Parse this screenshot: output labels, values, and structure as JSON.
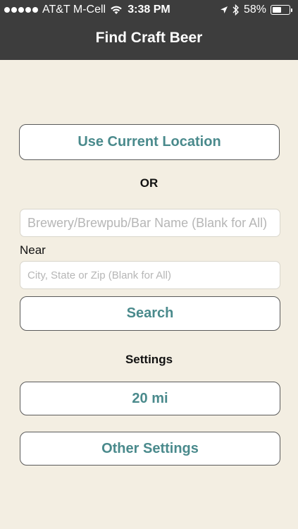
{
  "status_bar": {
    "carrier": "AT&T M-Cell",
    "time": "3:38 PM",
    "battery_percent": "58%",
    "battery_level": 0.58,
    "icons": [
      "signal-dots-icon",
      "wifi-icon",
      "location-arrow-icon",
      "bluetooth-icon",
      "battery-icon"
    ]
  },
  "nav": {
    "title": "Find Craft Beer"
  },
  "main": {
    "use_location_label": "Use Current Location",
    "or_label": "OR",
    "name_field": {
      "value": "",
      "placeholder": "Brewery/Brewpub/Bar Name (Blank for All)"
    },
    "near_label": "Near",
    "location_field": {
      "value": "",
      "placeholder": "City, State or Zip (Blank for All)"
    },
    "search_label": "Search",
    "settings_label": "Settings",
    "radius_label": "20 mi",
    "other_settings_label": "Other Settings"
  },
  "colors": {
    "background": "#f3eee2",
    "topbar": "#3d3d3d",
    "accent_text": "#4a8a8c"
  }
}
